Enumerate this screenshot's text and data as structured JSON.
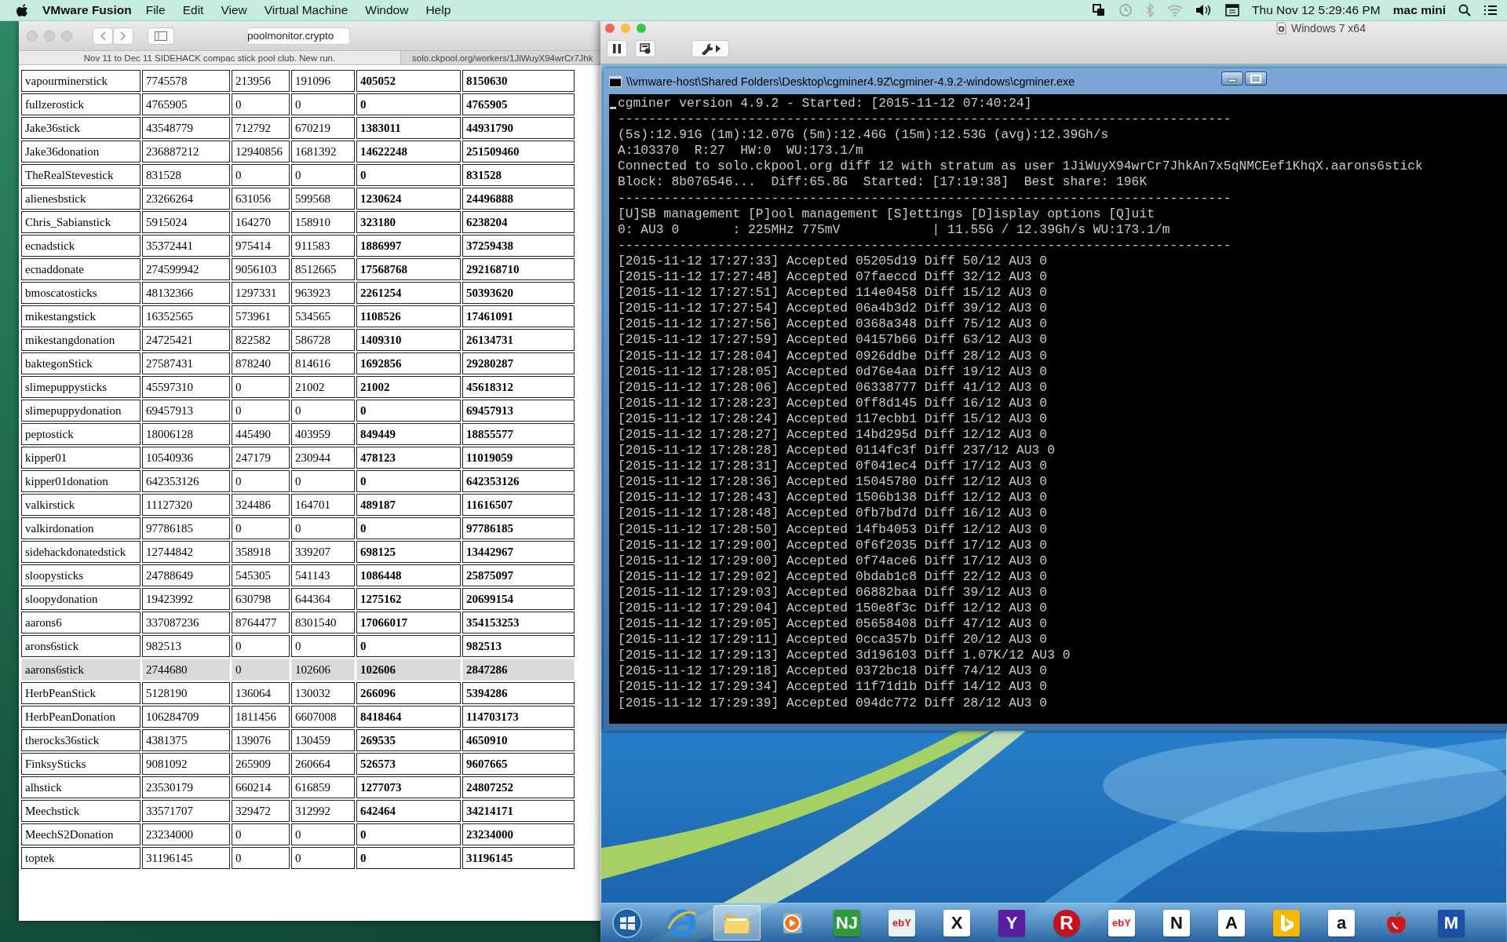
{
  "menu_bar": {
    "app": "VMware Fusion",
    "menus": [
      "File",
      "Edit",
      "View",
      "Virtual Machine",
      "Window",
      "Help"
    ],
    "clock": "Thu Nov 12  5:29:46 PM",
    "user": "mac mini"
  },
  "browser": {
    "address": "poolmonitor.crypto",
    "tabs": [
      {
        "label": "Nov 11 to Dec 11 SIDEHACK compac stick pool club. New run.",
        "selected": true
      },
      {
        "label": "solo.ckpool.org/workers/1JiWuyX94wrCr7Jhk",
        "selected": false
      }
    ],
    "table": {
      "rows": [
        {
          "cells": [
            "vapourminerstick",
            "7745578",
            "213956",
            "191096",
            "405052",
            "8150630"
          ],
          "selected": false
        },
        {
          "cells": [
            "fullzerostick",
            "4765905",
            "0",
            "0",
            "0",
            "4765905"
          ],
          "selected": false
        },
        {
          "cells": [
            "Jake36stick",
            "43548779",
            "712792",
            "670219",
            "1383011",
            "44931790"
          ],
          "selected": false
        },
        {
          "cells": [
            "Jake36donation",
            "236887212",
            "12940856",
            "1681392",
            "14622248",
            "251509460"
          ],
          "selected": false
        },
        {
          "cells": [
            "TheRealStevestick",
            "831528",
            "0",
            "0",
            "0",
            "831528"
          ],
          "selected": false
        },
        {
          "cells": [
            "alienesbstick",
            "23266264",
            "631056",
            "599568",
            "1230624",
            "24496888"
          ],
          "selected": false
        },
        {
          "cells": [
            "Chris_Sabianstick",
            "5915024",
            "164270",
            "158910",
            "323180",
            "6238204"
          ],
          "selected": false
        },
        {
          "cells": [
            "ecnadstick",
            "35372441",
            "975414",
            "911583",
            "1886997",
            "37259438"
          ],
          "selected": false
        },
        {
          "cells": [
            "ecnaddonate",
            "274599942",
            "9056103",
            "8512665",
            "17568768",
            "292168710"
          ],
          "selected": false
        },
        {
          "cells": [
            "bmoscatosticks",
            "48132366",
            "1297331",
            "963923",
            "2261254",
            "50393620"
          ],
          "selected": false
        },
        {
          "cells": [
            "mikestangstick",
            "16352565",
            "573961",
            "534565",
            "1108526",
            "17461091"
          ],
          "selected": false
        },
        {
          "cells": [
            "mikestangdonation",
            "24725421",
            "822582",
            "586728",
            "1409310",
            "26134731"
          ],
          "selected": false
        },
        {
          "cells": [
            "baktegonStick",
            "27587431",
            "878240",
            "814616",
            "1692856",
            "29280287"
          ],
          "selected": false
        },
        {
          "cells": [
            "slimepuppysticks",
            "45597310",
            "0",
            "21002",
            "21002",
            "45618312"
          ],
          "selected": false
        },
        {
          "cells": [
            "slimepuppydonation",
            "69457913",
            "0",
            "0",
            "0",
            "69457913"
          ],
          "selected": false
        },
        {
          "cells": [
            "peptostick",
            "18006128",
            "445490",
            "403959",
            "849449",
            "18855577"
          ],
          "selected": false
        },
        {
          "cells": [
            "kipper01",
            "10540936",
            "247179",
            "230944",
            "478123",
            "11019059"
          ],
          "selected": false
        },
        {
          "cells": [
            "kipper01donation",
            "642353126",
            "0",
            "0",
            "0",
            "642353126"
          ],
          "selected": false
        },
        {
          "cells": [
            "valkirstick",
            "11127320",
            "324486",
            "164701",
            "489187",
            "11616507"
          ],
          "selected": false
        },
        {
          "cells": [
            "valkirdonation",
            "97786185",
            "0",
            "0",
            "0",
            "97786185"
          ],
          "selected": false
        },
        {
          "cells": [
            "sidehackdonatedstick",
            "12744842",
            "358918",
            "339207",
            "698125",
            "13442967"
          ],
          "selected": false
        },
        {
          "cells": [
            "sloopysticks",
            "24788649",
            "545305",
            "541143",
            "1086448",
            "25875097"
          ],
          "selected": false
        },
        {
          "cells": [
            "sloopydonation",
            "19423992",
            "630798",
            "644364",
            "1275162",
            "20699154"
          ],
          "selected": false
        },
        {
          "cells": [
            "aarons6",
            "337087236",
            "8764477",
            "8301540",
            "17066017",
            "354153253"
          ],
          "selected": false
        },
        {
          "cells": [
            "arons6stick",
            "982513",
            "0",
            "0",
            "0",
            "982513"
          ],
          "selected": false
        },
        {
          "cells": [
            "aarons6stick",
            "2744680",
            "0",
            "102606",
            "102606",
            "2847286"
          ],
          "selected": true
        },
        {
          "cells": [
            "HerbPeanStick",
            "5128190",
            "136064",
            "130032",
            "266096",
            "5394286"
          ],
          "selected": false
        },
        {
          "cells": [
            "HerbPeanDonation",
            "106284709",
            "1811456",
            "6607008",
            "8418464",
            "114703173"
          ],
          "selected": false
        },
        {
          "cells": [
            "therocks36stick",
            "4381375",
            "139076",
            "130459",
            "269535",
            "4650910"
          ],
          "selected": false
        },
        {
          "cells": [
            "FinksySticks",
            "9081092",
            "265909",
            "260664",
            "526573",
            "9607665"
          ],
          "selected": false
        },
        {
          "cells": [
            "alhstick",
            "23530179",
            "660214",
            "616859",
            "1277073",
            "24807252"
          ],
          "selected": false
        },
        {
          "cells": [
            "Meechstick",
            "33571707",
            "329472",
            "312992",
            "642464",
            "34214171"
          ],
          "selected": false
        },
        {
          "cells": [
            "MeechS2Donation",
            "23234000",
            "0",
            "0",
            "0",
            "23234000"
          ],
          "selected": false
        },
        {
          "cells": [
            "toptek",
            "31196145",
            "0",
            "0",
            "0",
            "31196145"
          ],
          "selected": false
        }
      ]
    }
  },
  "vm_window": {
    "title": "Windows 7 x64",
    "console": {
      "title": "\\\\vmware-host\\Shared Folders\\Desktop\\cgminer4.9Z\\cgminer-4.9.2-windows\\cgminer.exe",
      "lines": [
        "cgminer version 4.9.2 - Started: [2015-11-12 07:40:24]",
        "--------------------------------------------------------------------------------",
        "(5s):12.91G (1m):12.07G (5m):12.46G (15m):12.53G (avg):12.39Gh/s",
        "A:103370  R:27  HW:0  WU:173.1/m",
        "Connected to solo.ckpool.org diff 12 with stratum as user 1JiWuyX94wrCr7JhkAn7x5qNMCEef1KhqX.aarons6stick",
        "Block: 8b076546...  Diff:65.8G  Started: [17:19:38]  Best share: 196K",
        "--------------------------------------------------------------------------------",
        "[U]SB management [P]ool management [S]ettings [D]isplay options [Q]uit",
        "0: AU3 0       : 225MHz 775mV            | 11.55G / 12.39Gh/s WU:173.1/m",
        "--------------------------------------------------------------------------------",
        "[2015-11-12 17:27:33] Accepted 05205d19 Diff 50/12 AU3 0",
        "[2015-11-12 17:27:48] Accepted 07faeccd Diff 32/12 AU3 0",
        "[2015-11-12 17:27:51] Accepted 114e0458 Diff 15/12 AU3 0",
        "[2015-11-12 17:27:54] Accepted 06a4b3d2 Diff 39/12 AU3 0",
        "[2015-11-12 17:27:56] Accepted 0368a348 Diff 75/12 AU3 0",
        "[2015-11-12 17:27:59] Accepted 04157b66 Diff 63/12 AU3 0",
        "[2015-11-12 17:28:04] Accepted 0926ddbe Diff 28/12 AU3 0",
        "[2015-11-12 17:28:05] Accepted 0d76e4aa Diff 19/12 AU3 0",
        "[2015-11-12 17:28:06] Accepted 06338777 Diff 41/12 AU3 0",
        "[2015-11-12 17:28:23] Accepted 0ff8d145 Diff 16/12 AU3 0",
        "[2015-11-12 17:28:24] Accepted 117ecbb1 Diff 15/12 AU3 0",
        "[2015-11-12 17:28:27] Accepted 14bd295d Diff 12/12 AU3 0",
        "[2015-11-12 17:28:28] Accepted 0114fc3f Diff 237/12 AU3 0",
        "[2015-11-12 17:28:31] Accepted 0f041ec4 Diff 17/12 AU3 0",
        "[2015-11-12 17:28:36] Accepted 15045780 Diff 12/12 AU3 0",
        "[2015-11-12 17:28:43] Accepted 1506b138 Diff 12/12 AU3 0",
        "[2015-11-12 17:28:48] Accepted 0fb7bd7d Diff 16/12 AU3 0",
        "[2015-11-12 17:28:50] Accepted 14fb4053 Diff 12/12 AU3 0",
        "[2015-11-12 17:29:00] Accepted 0f6f2035 Diff 17/12 AU3 0",
        "[2015-11-12 17:29:00] Accepted 0f74ace6 Diff 17/12 AU3 0",
        "[2015-11-12 17:29:02] Accepted 0bdab1c8 Diff 22/12 AU3 0",
        "[2015-11-12 17:29:03] Accepted 06882baa Diff 39/12 AU3 0",
        "[2015-11-12 17:29:04] Accepted 150e8f3c Diff 12/12 AU3 0",
        "[2015-11-12 17:29:05] Accepted 05658408 Diff 47/12 AU3 0",
        "[2015-11-12 17:29:11] Accepted 0cca357b Diff 20/12 AU3 0",
        "[2015-11-12 17:29:13] Accepted 3d196103 Diff 1.07K/12 AU3 0",
        "[2015-11-12 17:29:18] Accepted 0372bc18 Diff 74/12 AU3 0",
        "[2015-11-12 17:29:34] Accepted 11f71d1b Diff 14/12 AU3 0",
        "[2015-11-12 17:29:39] Accepted 094dc772 Diff 28/12 AU3 0"
      ]
    },
    "taskbar": {
      "items": [
        {
          "kind": "start",
          "active": false
        },
        {
          "kind": "browser",
          "active": false
        },
        {
          "kind": "folder",
          "active": true
        },
        {
          "kind": "media",
          "active": false
        },
        {
          "kind": "tile",
          "glyph": "NJ",
          "color": "#2e9a3a",
          "active": false
        },
        {
          "kind": "tile",
          "glyph": "ebY",
          "color": "#e8f0f8",
          "active": false
        },
        {
          "kind": "tile",
          "glyph": "X",
          "color": "#ffffff",
          "active": false
        },
        {
          "kind": "tile",
          "glyph": "Y",
          "color": "#5a1fa0",
          "active": false
        },
        {
          "kind": "round",
          "glyph": "R",
          "color": "#c8101a",
          "active": false
        },
        {
          "kind": "tile",
          "glyph": "ebY",
          "color": "#ffffff",
          "active": false
        },
        {
          "kind": "tile",
          "glyph": "N",
          "color": "#ffffff",
          "active": false
        },
        {
          "kind": "tile",
          "glyph": "A",
          "color": "#ffffff",
          "active": false
        },
        {
          "kind": "tile",
          "color": "#f5b800",
          "active": false
        },
        {
          "kind": "tile",
          "glyph": "a",
          "color": "#ffffff",
          "active": false
        },
        {
          "kind": "fruit",
          "color": "#d01818",
          "active": false
        },
        {
          "kind": "tile",
          "glyph": "M",
          "color": "#1e4fa8",
          "active": false
        }
      ]
    }
  }
}
